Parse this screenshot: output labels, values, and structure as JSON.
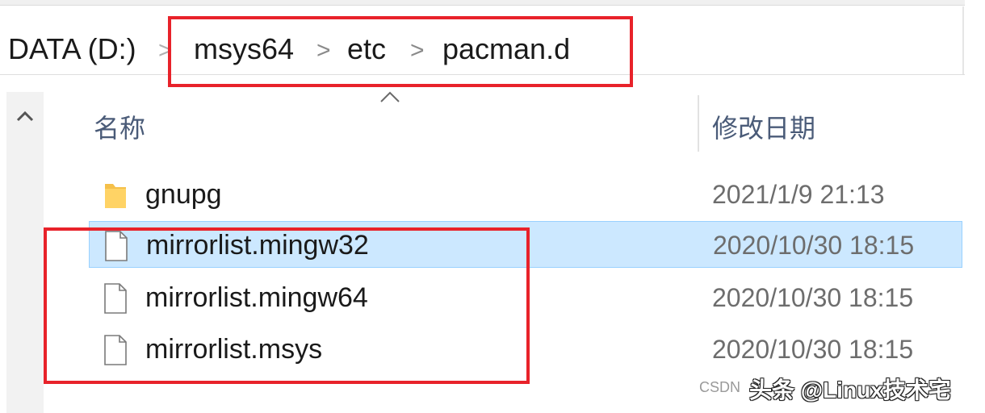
{
  "breadcrumb": {
    "items": [
      "DATA (D:)",
      "msys64",
      "etc",
      "pacman.d"
    ],
    "separator": ">"
  },
  "columns": {
    "name": "名称",
    "modified": "修改日期"
  },
  "files": [
    {
      "name": "gnupg",
      "modified": "2021/1/9 21:13",
      "type": "folder",
      "icon": "folder-icon",
      "selected": false
    },
    {
      "name": "mirrorlist.mingw32",
      "modified": "2020/10/30 18:15",
      "type": "file",
      "icon": "file-icon",
      "selected": true
    },
    {
      "name": "mirrorlist.mingw64",
      "modified": "2020/10/30 18:15",
      "type": "file",
      "icon": "file-icon",
      "selected": false
    },
    {
      "name": "mirrorlist.msys",
      "modified": "2020/10/30 18:15",
      "type": "file",
      "icon": "file-icon",
      "selected": false
    }
  ],
  "watermark": {
    "small": "CSDN",
    "main": "头条 @Linux技术宅"
  },
  "colors": {
    "selection": "#cce8ff",
    "annotation": "#e8222a",
    "header_text": "#4a5b78",
    "folder": "#f5c04a"
  }
}
